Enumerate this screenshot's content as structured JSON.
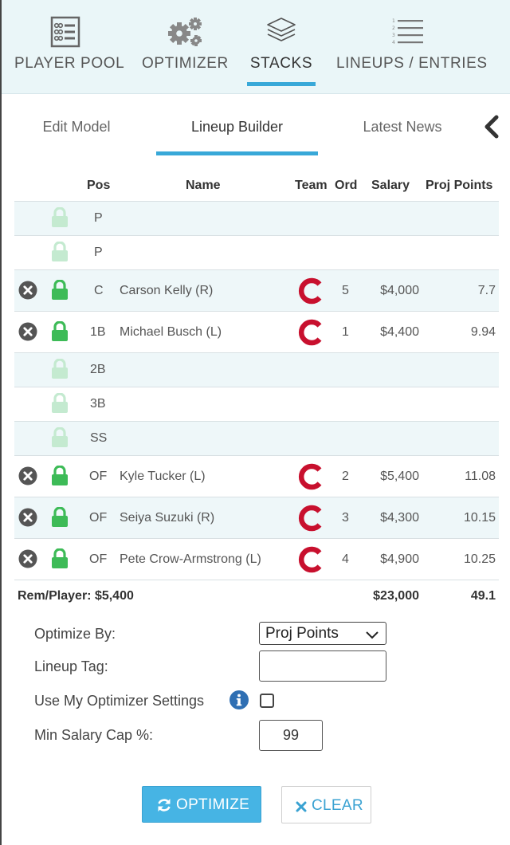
{
  "nav": {
    "items": [
      {
        "label": "PLAYER POOL",
        "icon": "player-list-icon"
      },
      {
        "label": "OPTIMIZER",
        "icon": "gears-icon"
      },
      {
        "label": "STACKS",
        "icon": "layers-icon",
        "active": true
      },
      {
        "label": "LINEUPS / ENTRIES",
        "icon": "numbered-list-icon"
      }
    ]
  },
  "subtabs": {
    "items": [
      {
        "label": "Edit Model"
      },
      {
        "label": "Lineup Builder",
        "active": true
      },
      {
        "label": "Latest News"
      }
    ],
    "scroll_icon": "chevron-left-icon"
  },
  "table": {
    "headers": {
      "pos": "Pos",
      "name": "Name",
      "team": "Team",
      "ord": "Ord",
      "salary": "Salary",
      "proj": "Proj Points"
    },
    "rows": [
      {
        "pos": "P",
        "name": "",
        "ord": "",
        "salary": "",
        "proj": "",
        "filled": false
      },
      {
        "pos": "P",
        "name": "",
        "ord": "",
        "salary": "",
        "proj": "",
        "filled": false
      },
      {
        "pos": "C",
        "name": "Carson Kelly (R)",
        "ord": "5",
        "salary": "$4,000",
        "proj": "7.7",
        "filled": true
      },
      {
        "pos": "1B",
        "name": "Michael Busch (L)",
        "ord": "1",
        "salary": "$4,400",
        "proj": "9.94",
        "filled": true
      },
      {
        "pos": "2B",
        "name": "",
        "ord": "",
        "salary": "",
        "proj": "",
        "filled": false
      },
      {
        "pos": "3B",
        "name": "",
        "ord": "",
        "salary": "",
        "proj": "",
        "filled": false
      },
      {
        "pos": "SS",
        "name": "",
        "ord": "",
        "salary": "",
        "proj": "",
        "filled": false
      },
      {
        "pos": "OF",
        "name": "Kyle Tucker (L)",
        "ord": "2",
        "salary": "$5,400",
        "proj": "11.08",
        "filled": true
      },
      {
        "pos": "OF",
        "name": "Seiya Suzuki (R)",
        "ord": "3",
        "salary": "$4,300",
        "proj": "10.15",
        "filled": true
      },
      {
        "pos": "OF",
        "name": "Pete Crow-Armstrong (L)",
        "ord": "4",
        "salary": "$4,900",
        "proj": "10.25",
        "filled": true
      }
    ],
    "totals": {
      "rem_player": "Rem/Player: $5,400",
      "salary": "$23,000",
      "proj": "49.1"
    }
  },
  "form": {
    "optimize_by_label": "Optimize By:",
    "optimize_by_value": "Proj Points",
    "lineup_tag_label": "Lineup Tag:",
    "lineup_tag_value": "",
    "use_settings_label": "Use My Optimizer Settings",
    "use_settings_checked": false,
    "min_salary_label": "Min Salary Cap %:",
    "min_salary_value": "99"
  },
  "buttons": {
    "optimize_label": "OPTIMIZE",
    "clear_label": "CLEAR"
  },
  "colors": {
    "accent": "#38a8d8",
    "lock_on": "#3dbb57",
    "lock_off": "#c4ead0",
    "team_logo": "#c8102e",
    "row_tint": "#eef7f9",
    "nav_bg": "#eaf6f8"
  }
}
